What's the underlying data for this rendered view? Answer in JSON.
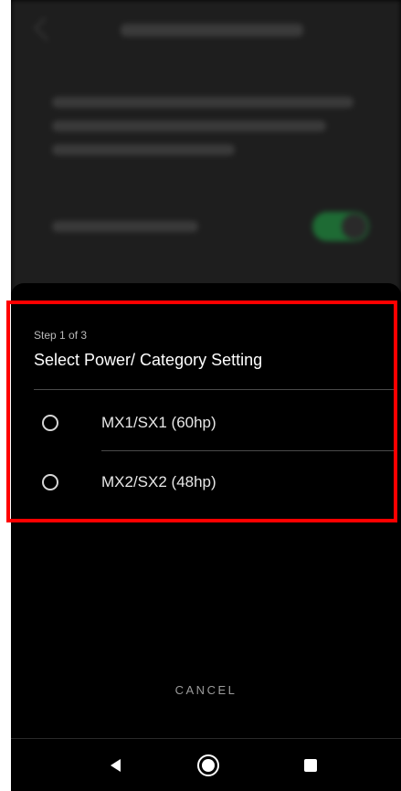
{
  "sheet": {
    "step_label": "Step 1 of 3",
    "title": "Select Power/ Category Setting",
    "options": [
      {
        "label": "MX1/SX1 (60hp)",
        "selected": false
      },
      {
        "label": "MX2/SX2 (48hp)",
        "selected": false
      }
    ],
    "cancel_label": "CANCEL"
  },
  "navbar": {
    "back_icon": "back-triangle-icon",
    "home_icon": "home-circle-icon",
    "recents_icon": "recents-square-icon"
  },
  "colors": {
    "sheet_background": "#000000",
    "highlight_border": "#ff0000",
    "toggle_background": "#1e6b34"
  }
}
